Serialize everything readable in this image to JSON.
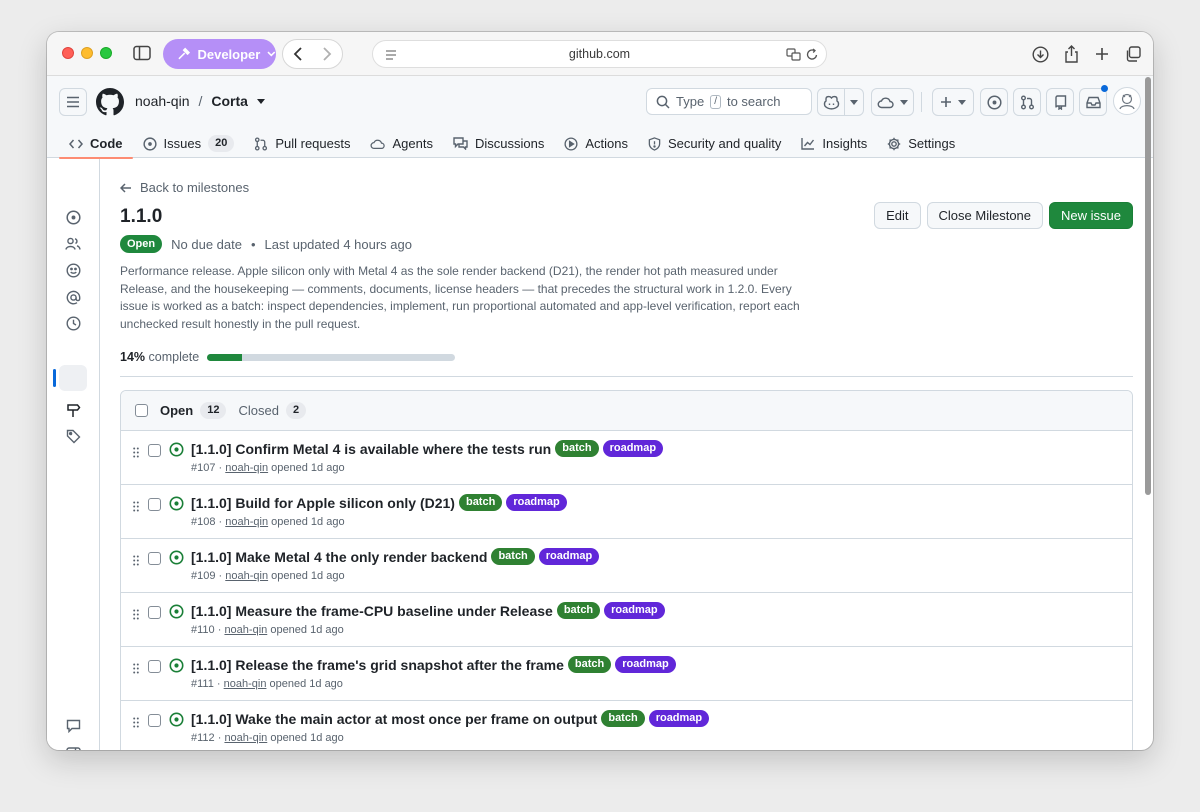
{
  "browser": {
    "developer_label": "Developer",
    "url": "github.com"
  },
  "header": {
    "owner": "noah-qin",
    "separator": "/",
    "repo": "Corta",
    "search_prefix": "Type",
    "search_key": "/",
    "search_suffix": "to search"
  },
  "tabs": [
    {
      "label": "Code"
    },
    {
      "label": "Issues",
      "count": "20"
    },
    {
      "label": "Pull requests"
    },
    {
      "label": "Agents"
    },
    {
      "label": "Discussions"
    },
    {
      "label": "Actions"
    },
    {
      "label": "Security and quality"
    },
    {
      "label": "Insights"
    },
    {
      "label": "Settings"
    }
  ],
  "milestone": {
    "back_label": "Back to milestones",
    "title": "1.1.0",
    "edit_label": "Edit",
    "close_label": "Close Milestone",
    "new_issue_label": "New issue",
    "state": "Open",
    "due": "No due date",
    "bullet": "•",
    "updated": "Last updated 4 hours ago",
    "description": "Performance release. Apple silicon only with Metal 4 as the sole render backend (D21), the render hot path measured under Release, and the housekeeping — comments, documents, license headers — that precedes the structural work in 1.2.0. Every issue is worked as a batch: inspect dependencies, implement, run proportional automated and app-level verification, report each unchecked result honestly in the pull request.",
    "percent": "14%",
    "percent_label": "complete",
    "progress_fraction": 0.14
  },
  "issue_list": {
    "open_label": "Open",
    "open_count": "12",
    "closed_label": "Closed",
    "closed_count": "2",
    "label_colors": {
      "batch": "#2f8132",
      "roadmap": "#6127d9"
    },
    "issues": [
      {
        "title": "[1.1.0] Confirm Metal 4 is available where the tests run",
        "number": "#107",
        "author": "noah-qin",
        "opened": "opened 1d ago",
        "labels": [
          "batch",
          "roadmap"
        ]
      },
      {
        "title": "[1.1.0] Build for Apple silicon only (D21)",
        "number": "#108",
        "author": "noah-qin",
        "opened": "opened 1d ago",
        "labels": [
          "batch",
          "roadmap"
        ]
      },
      {
        "title": "[1.1.0] Make Metal 4 the only render backend",
        "number": "#109",
        "author": "noah-qin",
        "opened": "opened 1d ago",
        "labels": [
          "batch",
          "roadmap"
        ]
      },
      {
        "title": "[1.1.0] Measure the frame-CPU baseline under Release",
        "number": "#110",
        "author": "noah-qin",
        "opened": "opened 1d ago",
        "labels": [
          "batch",
          "roadmap"
        ]
      },
      {
        "title": "[1.1.0] Release the frame's grid snapshot after the frame",
        "number": "#111",
        "author": "noah-qin",
        "opened": "opened 1d ago",
        "labels": [
          "batch",
          "roadmap"
        ]
      },
      {
        "title": "[1.1.0] Wake the main actor at most once per frame on output",
        "number": "#112",
        "author": "noah-qin",
        "opened": "opened 1d ago",
        "labels": [
          "batch",
          "roadmap"
        ]
      }
    ]
  }
}
